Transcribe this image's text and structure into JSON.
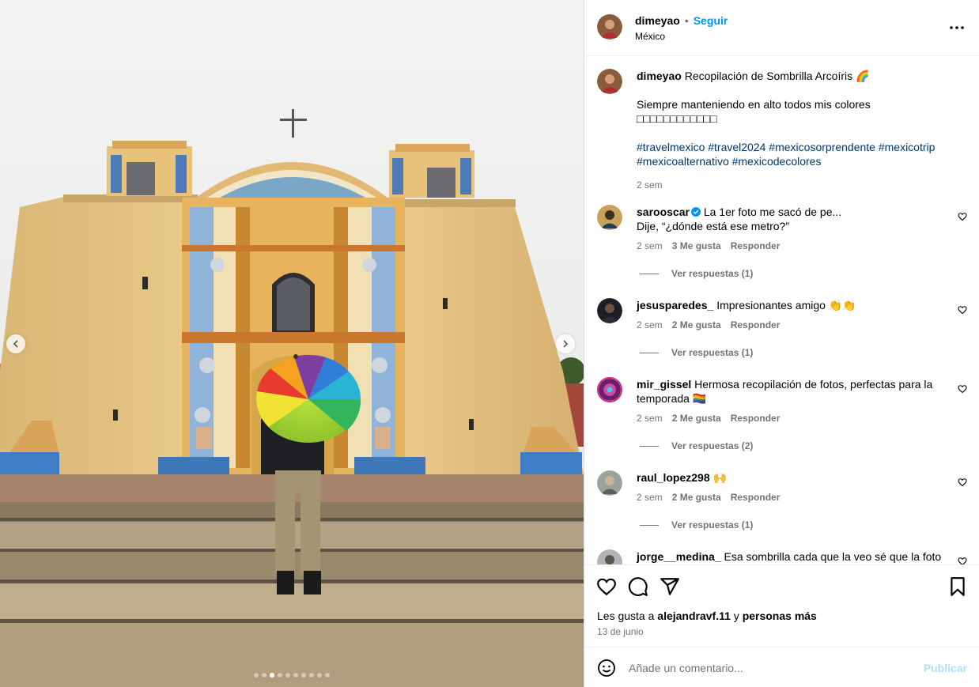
{
  "post": {
    "username": "dimeyao",
    "follow_label": "Seguir",
    "separator": "•",
    "location": "México",
    "more_icon": "more-horizontal-icon"
  },
  "caption": {
    "username": "dimeyao",
    "title": "Recopilación de Sombrilla Arcoíris 🌈",
    "line2": "Siempre manteniendo en alto todos mis colores",
    "line3": "□□□□□□□□□□□□",
    "hashtags_line1": "#travelmexico #travel2024 #mexicosorprendente #mexicotrip",
    "hashtags_line2": "#mexicoalternativo #mexicodecolores",
    "time": "2 sem"
  },
  "comments": [
    {
      "username": "sarooscar",
      "verified": true,
      "text_line1": "La 1er foto me sacó de pe...",
      "text_line2": "Dije, “¿dónde está ese metro?”",
      "time": "2 sem",
      "likes": "3 Me gusta",
      "reply": "Responder",
      "view_replies": "Ver respuestas (1)"
    },
    {
      "username": "jesusparedes_",
      "text_line1": "Impresionantes amigo 👏👏",
      "time": "2 sem",
      "likes": "2 Me gusta",
      "reply": "Responder",
      "view_replies": "Ver respuestas (1)"
    },
    {
      "username": "mir_gissel",
      "text_line1": "Hermosa recopilación de fotos, perfectas para la",
      "text_line2": "temporada 🏳️‍🌈",
      "time": "2 sem",
      "likes": "2 Me gusta",
      "reply": "Responder",
      "view_replies": "Ver respuestas (2)"
    },
    {
      "username": "raul_lopez298",
      "text_line1": "🙌",
      "time": "2 sem",
      "likes": "2 Me gusta",
      "reply": "Responder",
      "view_replies": "Ver respuestas (1)"
    },
    {
      "username": "jorge__medina_",
      "text_line1": "Esa sombrilla cada que la veo sé que la foto es"
    }
  ],
  "actions": {
    "like_icon": "heart-icon",
    "comment_icon": "comment-icon",
    "share_icon": "send-icon",
    "save_icon": "bookmark-icon",
    "likes_prefix": "Les gusta a",
    "likes_user": "alejandravf.11",
    "likes_middle": "y",
    "likes_suffix": "personas más",
    "date": "13 de junio"
  },
  "composer": {
    "placeholder": "Añade un comentario...",
    "post_label": "Publicar",
    "emoji_icon": "smiley-icon"
  },
  "carousel": {
    "slide_count": 10,
    "active_index": 2
  },
  "colors": {
    "link_blue": "#0095f6",
    "hashtag": "#00376b",
    "muted": "#737373",
    "post_disabled": "#b2dffc"
  }
}
